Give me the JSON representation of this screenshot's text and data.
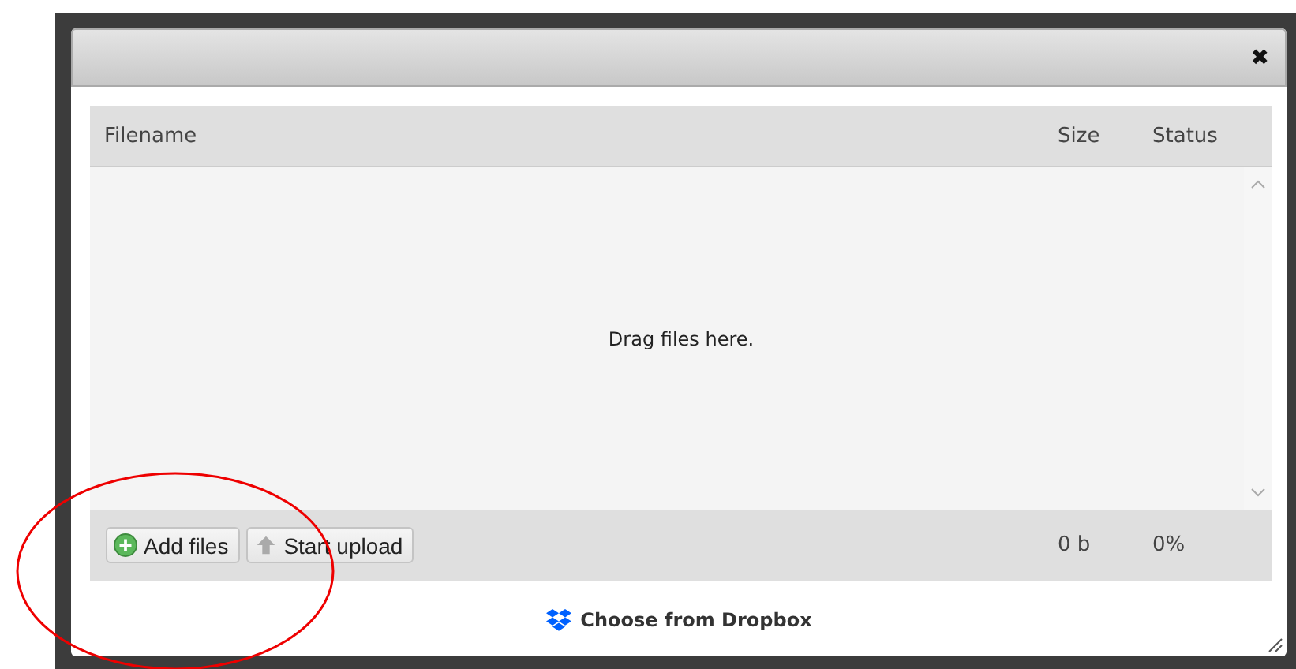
{
  "dialog": {
    "close": "✖"
  },
  "table": {
    "columns": [
      "Filename",
      "Size",
      "Status"
    ],
    "empty_message": "Drag files here."
  },
  "footer": {
    "buttons": [
      {
        "kind": "add",
        "label": "Add files"
      },
      {
        "kind": "upload",
        "label": "Start upload"
      }
    ],
    "total_size": "0 b",
    "total_percent": "0%"
  },
  "dropbox_link": "Choose from Dropbox"
}
